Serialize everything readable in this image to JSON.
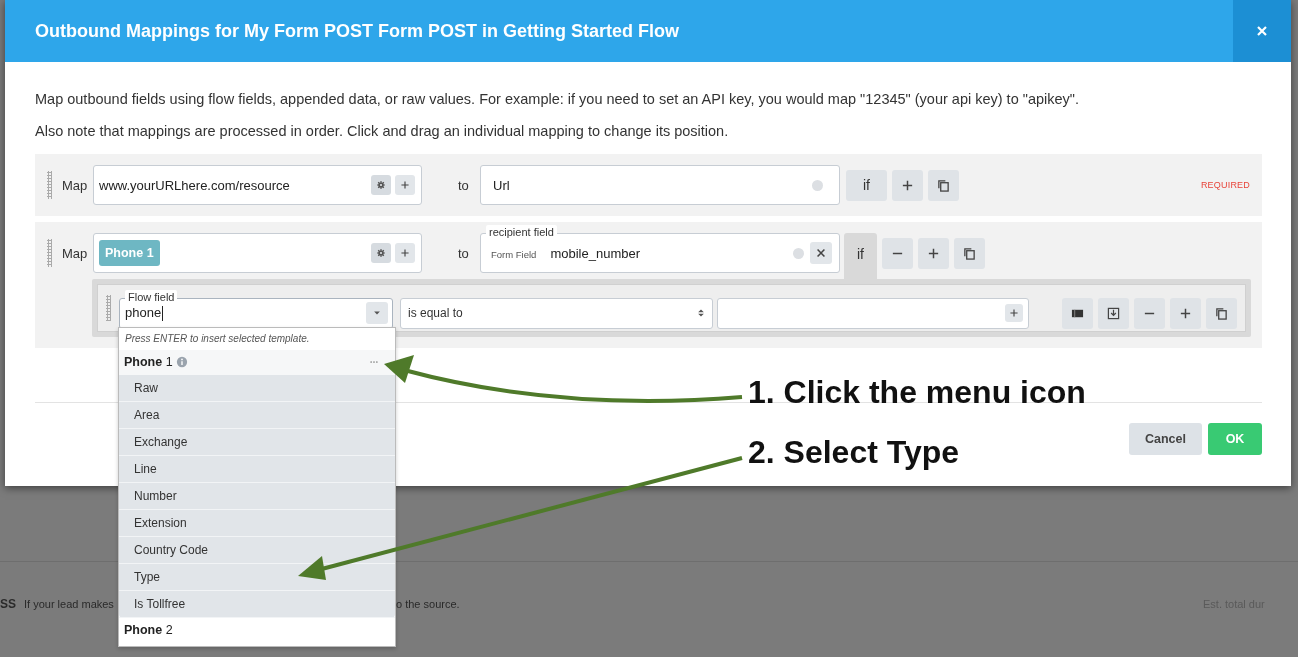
{
  "background_page": {
    "texts": [
      {
        "kind": "heading",
        "text": "SS"
      },
      {
        "kind": "body",
        "text": "If your lead makes"
      },
      {
        "kind": "body",
        "text": "o the source."
      },
      {
        "kind": "aside",
        "text": "Est. total dur"
      }
    ]
  },
  "modal": {
    "title": "Outbound Mappings for My Form POST Form POST in Getting Started Flow",
    "intro": [
      "Map outbound fields using flow fields, appended data, or raw values. For example: if you need to set an API key, you would map \"12345\" (your api key) to \"apikey\".",
      "Also note that mappings are processed in order. Click and drag an individual mapping to change its position."
    ],
    "mappings": [
      {
        "label": "Map",
        "source": {
          "kind": "text",
          "value": "www.yourURLhere.com/resource"
        },
        "connector": "to",
        "target": {
          "kind": "plain",
          "value": "Url"
        },
        "if_label": "if",
        "if_open": false,
        "removable": false,
        "note": "REQUIRED"
      },
      {
        "label": "Map",
        "source": {
          "kind": "chip",
          "value": "Phone 1"
        },
        "connector": "to",
        "target": {
          "kind": "recipient",
          "legend": "recipient field",
          "tag": "Form Field",
          "value": "mobile_number"
        },
        "if_label": "if",
        "if_open": true,
        "removable": true,
        "conditions": [
          {
            "field": {
              "legend": "Flow field",
              "value": "phone",
              "focused": true
            },
            "operator": "is equal to",
            "dropdown": {
              "hint": "Press ENTER to insert selected template.",
              "groups": [
                {
                  "label": "**Phone** 1",
                  "expanded": true,
                  "items": [
                    {
                      "label": "Raw"
                    },
                    {
                      "label": "Area"
                    },
                    {
                      "label": "Exchange"
                    },
                    {
                      "label": "Line"
                    },
                    {
                      "label": "Number"
                    },
                    {
                      "label": "Extension"
                    },
                    {
                      "label": "Country Code"
                    },
                    {
                      "label": "Type"
                    },
                    {
                      "label": "Is Tollfree"
                    }
                  ]
                },
                {
                  "label": "**Phone** 2",
                  "expanded": false
                }
              ]
            }
          }
        ]
      }
    ],
    "buttons": [
      {
        "label": "Cancel",
        "kind": "secondary"
      },
      {
        "label": "OK",
        "kind": "primary"
      }
    ]
  },
  "annotations": [
    {
      "text": "1. Click the menu icon"
    },
    {
      "text": "2. Select Type"
    }
  ]
}
